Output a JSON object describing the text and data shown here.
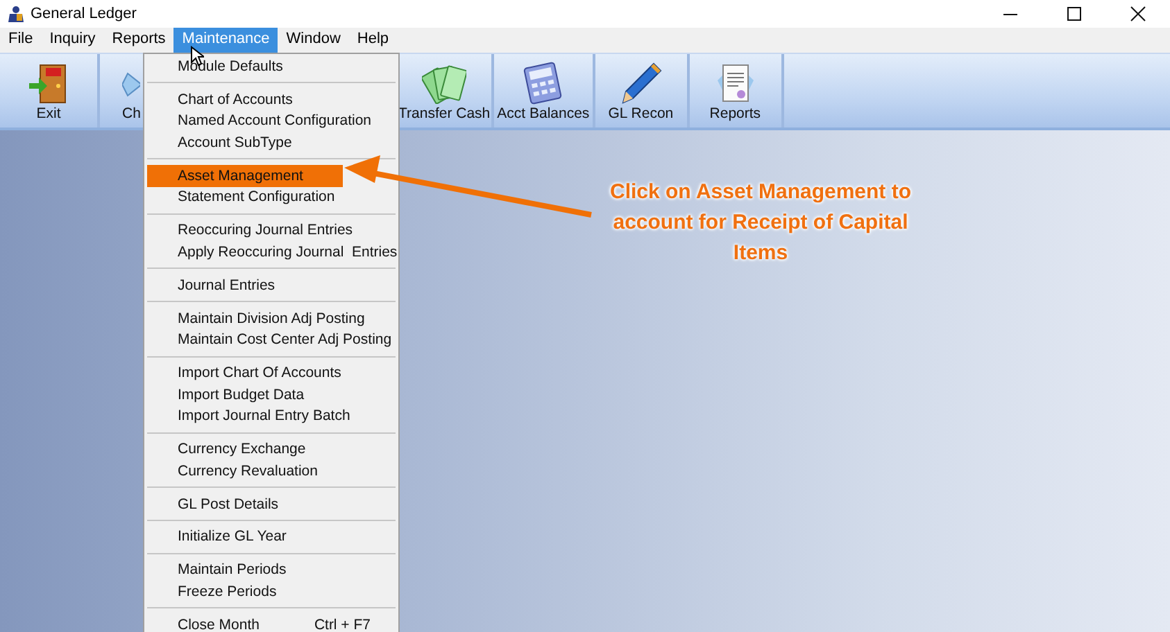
{
  "window": {
    "title": "General Ledger"
  },
  "menu_bar": [
    {
      "label": "File",
      "selected": false
    },
    {
      "label": "Inquiry",
      "selected": false
    },
    {
      "label": "Reports",
      "selected": false
    },
    {
      "label": "Maintenance",
      "selected": true
    },
    {
      "label": "Window",
      "selected": false
    },
    {
      "label": "Help",
      "selected": false
    }
  ],
  "toolbar": [
    {
      "label": "Exit",
      "kind": "exit"
    },
    {
      "label": "Ch",
      "kind": "chart"
    },
    {
      "label": "Transfer Cash",
      "kind": "cash"
    },
    {
      "label": "Acct Balances",
      "kind": "calculator"
    },
    {
      "label": "GL Recon",
      "kind": "pencil"
    },
    {
      "label": "Reports",
      "kind": "report"
    }
  ],
  "dropdown": {
    "groups": [
      [
        {
          "label": "Module Defaults",
          "highlighted": false
        }
      ],
      [
        {
          "label": "Chart of Accounts",
          "highlighted": false
        },
        {
          "label": "Named Account Configuration",
          "highlighted": false
        },
        {
          "label": "Account SubType",
          "highlighted": false
        }
      ],
      [
        {
          "label": "Asset Management",
          "highlighted": true
        },
        {
          "label": "Statement Configuration",
          "highlighted": false
        }
      ],
      [
        {
          "label": "Reoccuring Journal Entries",
          "highlighted": false
        },
        {
          "label": "Apply Reoccuring Journal  Entries",
          "highlighted": false
        }
      ],
      [
        {
          "label": "Journal Entries",
          "highlighted": false
        }
      ],
      [
        {
          "label": "Maintain Division Adj Posting",
          "highlighted": false
        },
        {
          "label": "Maintain Cost Center Adj Posting",
          "highlighted": false
        }
      ],
      [
        {
          "label": "Import Chart Of Accounts",
          "highlighted": false
        },
        {
          "label": "Import Budget Data",
          "highlighted": false
        },
        {
          "label": "Import Journal Entry Batch",
          "highlighted": false
        }
      ],
      [
        {
          "label": "Currency Exchange",
          "highlighted": false
        },
        {
          "label": "Currency Revaluation",
          "highlighted": false
        }
      ],
      [
        {
          "label": "GL Post Details",
          "highlighted": false
        }
      ],
      [
        {
          "label": "Initialize GL Year",
          "highlighted": false
        }
      ],
      [
        {
          "label": "Maintain Periods",
          "highlighted": false
        },
        {
          "label": "Freeze Periods",
          "highlighted": false
        }
      ],
      [
        {
          "label": "Close Month",
          "shortcut": "Ctrl + F7",
          "highlighted": false
        }
      ]
    ]
  },
  "callout": {
    "text": "Click on Asset Management to account for Receipt of Capital Items"
  }
}
